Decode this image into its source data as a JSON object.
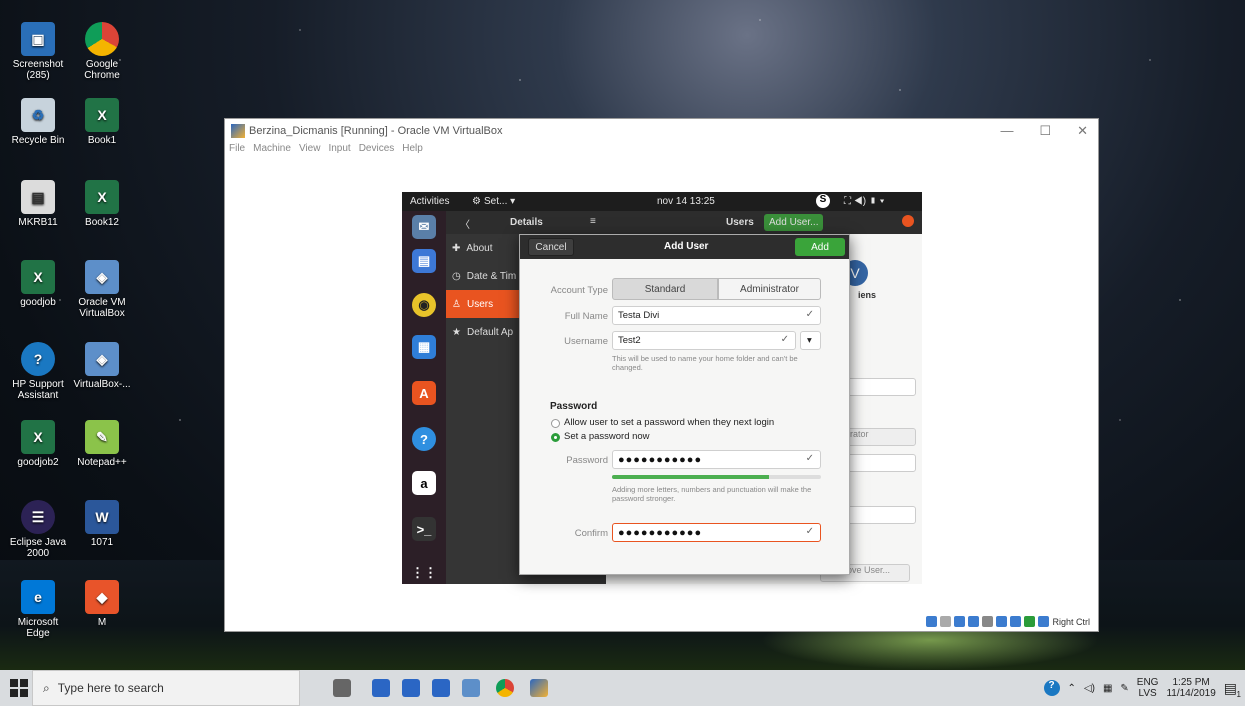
{
  "desktop": {
    "icons": [
      {
        "label": "Screenshot\n(285)"
      },
      {
        "label": "Google\nChrome"
      },
      {
        "label": "Recycle Bin"
      },
      {
        "label": "Book1"
      },
      {
        "label": "MKRB11"
      },
      {
        "label": "Book12"
      },
      {
        "label": "goodjob"
      },
      {
        "label": "Oracle VM\nVirtualBox"
      },
      {
        "label": "HP Support\nAssistant"
      },
      {
        "label": "VirtualBox-..."
      },
      {
        "label": "goodjob2"
      },
      {
        "label": "Notepad++"
      },
      {
        "label": "Eclipse Java\n2000"
      },
      {
        "label": "1071"
      },
      {
        "label": "Microsoft\nEdge"
      },
      {
        "label": "M"
      }
    ]
  },
  "vbox": {
    "title": "Berzina_Dicmanis [Running] - Oracle VM VirtualBox",
    "menu": [
      "File",
      "Machine",
      "View",
      "Input",
      "Devices",
      "Help"
    ],
    "host_key": "Right Ctrl",
    "minimize": "—",
    "maximize": "☐",
    "close": "✕"
  },
  "guest": {
    "topbar": {
      "activities": "Activities",
      "app_menu": "Set... ▾",
      "clock": "nov 14  13:25",
      "status": "⛶  ◀)  ▮  ▾"
    },
    "settings": {
      "back": "〈",
      "header_title": "Details",
      "menu_icon": "≡",
      "users_title": "Users",
      "add_user_btn": "Add User...",
      "sidebar": [
        {
          "label": "About",
          "icon": "✚"
        },
        {
          "label": "Date & Tim",
          "icon": "◷"
        },
        {
          "label": "Users",
          "icon": "♙"
        },
        {
          "label": "Default Ap",
          "icon": "★"
        }
      ],
      "main_partial_label1": "iens",
      "main_partial_label2": "rator",
      "remove_user": "ove User..."
    }
  },
  "dialog": {
    "title": "Add User",
    "cancel": "Cancel",
    "add": "Add",
    "account_type_label": "Account Type",
    "account_types": [
      "Standard",
      "Administrator"
    ],
    "full_name_label": "Full Name",
    "full_name_value": "Testa Divi",
    "username_label": "Username",
    "username_value": "Test2",
    "username_help": "This will be used to name your home folder and can't be changed.",
    "password_heading": "Password",
    "radio_option1": "Allow user to set a password when they next login",
    "radio_option2": "Set a password now",
    "password_label": "Password",
    "password_value": "●●●●●●●●●●●",
    "strength_help": "Adding more letters, numbers and punctuation will make the password stronger.",
    "password_strength": 0.75,
    "confirm_label": "Confirm",
    "confirm_value": "●●●●●●●●●●●"
  },
  "taskbar": {
    "search_placeholder": "Type here to search",
    "lang": "ENG",
    "layout": "LVS",
    "time": "1:25 PM",
    "date": "11/14/2019",
    "notification_count": "1"
  }
}
